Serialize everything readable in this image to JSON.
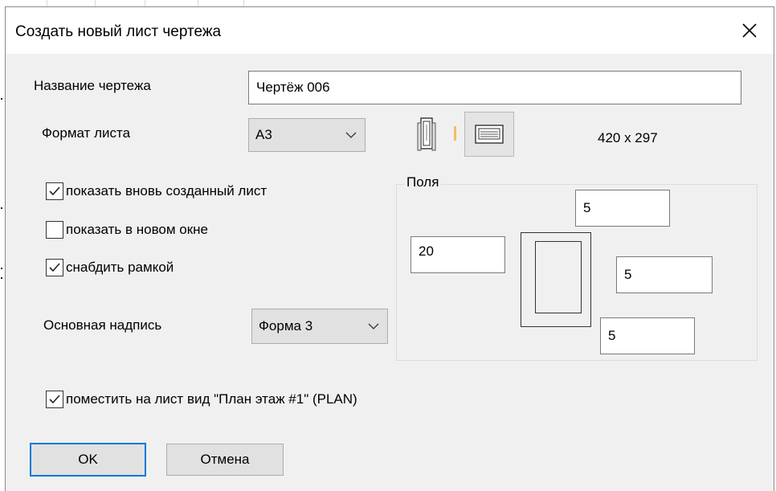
{
  "window": {
    "title": "Создать новый лист чертежа",
    "close_icon": "close-icon"
  },
  "drawing_name": {
    "label": "Название чертежа",
    "value": "Чертёж 006"
  },
  "sheet_format": {
    "label": "Формат листа",
    "selected": "A3",
    "size_text": "420 x 297",
    "portrait_icon": "portrait-sheet-icon",
    "landscape_icon": "landscape-sheet-icon",
    "selected_orientation": "landscape"
  },
  "options": {
    "show_new_sheet": {
      "label": "показать вновь созданный лист",
      "checked": true
    },
    "show_in_new_window": {
      "label": "показать в новом окне",
      "checked": false
    },
    "add_frame": {
      "label": "снабдить рамкой",
      "checked": true
    }
  },
  "title_block": {
    "label": "Основная надпись",
    "selected": "Форма 3"
  },
  "margins": {
    "legend": "Поля",
    "top": "5",
    "left": "20",
    "right": "5",
    "bottom": "5"
  },
  "place_view": {
    "label": "поместить на лист вид  \"План этаж #1\" (PLAN)",
    "checked": true
  },
  "buttons": {
    "ok": "OK",
    "cancel": "Отмена"
  },
  "colors": {
    "accent": "#0078d7",
    "dialog_bg": "#f0f0f0"
  }
}
